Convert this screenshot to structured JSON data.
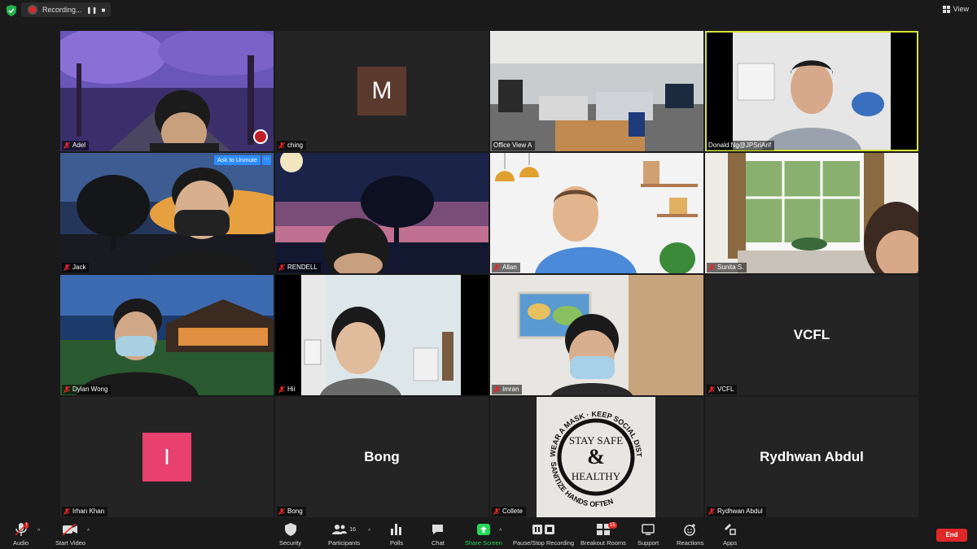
{
  "topbar": {
    "recording_label": "Recording...",
    "pause_glyph": "❚❚",
    "stop_glyph": "■",
    "view_label": "View"
  },
  "tiles": [
    {
      "name": "Adel"
    },
    {
      "name": "ching",
      "avatar_letter": "M",
      "avatar_color": "#5b3a2e"
    },
    {
      "name": "Office View A"
    },
    {
      "name": "Donald Ng@JPSriArif"
    },
    {
      "name": "Jack",
      "ask_unmute": "Ask to Unmute",
      "more": "···"
    },
    {
      "name": "RENDELL"
    },
    {
      "name": "Allan"
    },
    {
      "name": "Sunita S."
    },
    {
      "name": "Dylan Wong"
    },
    {
      "name": "Hii"
    },
    {
      "name": "Imran"
    },
    {
      "name": "VCFL",
      "display_name": "VCFL"
    },
    {
      "name": "Irhan Khan",
      "avatar_letter": "I",
      "avatar_color": "#e8416f"
    },
    {
      "name": "Bong",
      "display_name": "Bong"
    },
    {
      "name": "Collete",
      "sign": {
        "top": "WEAR A MASK · KEEP SOCIAL DISTANCE",
        "bottom": "SANITIZE HANDS OFTEN",
        "line1": "STAY SAFE",
        "amp": "&",
        "line2": "HEALTHY"
      }
    },
    {
      "name": "Rydhwan Abdul",
      "display_name": "Rydhwan Abdul"
    }
  ],
  "toolbar": {
    "audio": "Audio",
    "audio_badge": "!",
    "start_video": "Start Video",
    "security": "Security",
    "participants": "Participants",
    "participants_count": "16",
    "polls": "Polls",
    "chat": "Chat",
    "share_screen": "Share Screen",
    "pause_stop_recording": "Pause/Stop Recording",
    "breakout_rooms": "Breakout Rooms",
    "breakout_badge": "15",
    "support": "Support",
    "reactions": "Reactions",
    "apps": "Apps",
    "end": "End"
  },
  "colors": {
    "active_speaker": "#d6e23a",
    "share_green": "#23d959",
    "end_red": "#e02828",
    "unmute_blue": "#2d8cff"
  }
}
